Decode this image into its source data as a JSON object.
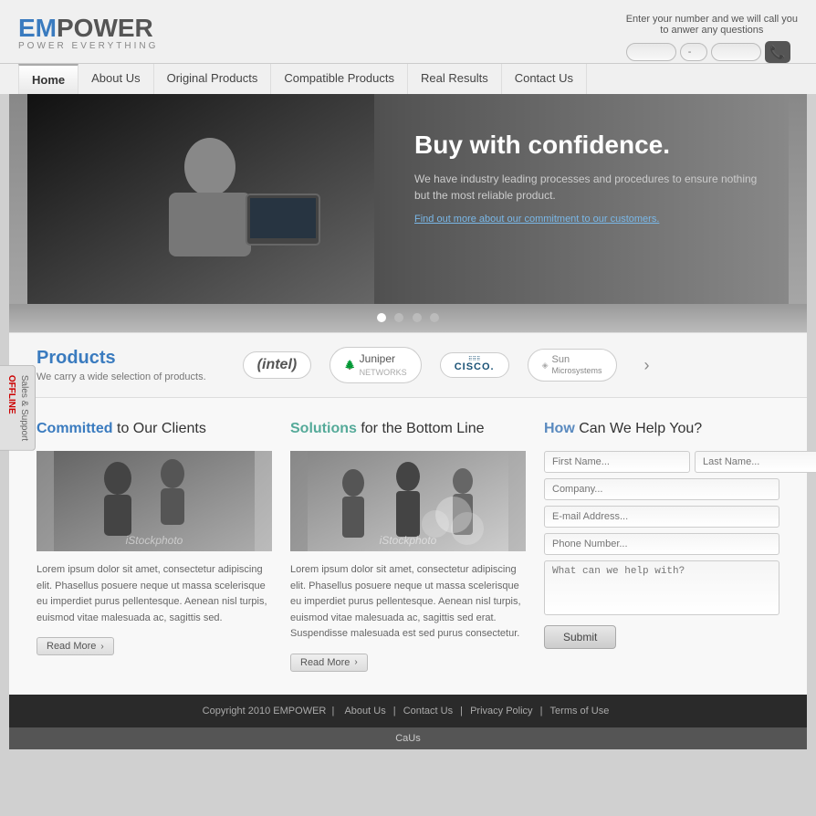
{
  "header": {
    "logo_em": "EM",
    "logo_power": "POWER",
    "logo_sub": "POWER  EVERYTHING",
    "call_label": "Enter your number and we will call you",
    "call_label2": "to anwer any questions",
    "phone_input1_placeholder": "",
    "phone_input2_placeholder": "-",
    "phone_input3_placeholder": ""
  },
  "nav": {
    "items": [
      {
        "label": "Home",
        "active": true
      },
      {
        "label": "About Us",
        "active": false
      },
      {
        "label": "Original Products",
        "active": false
      },
      {
        "label": "Compatible Products",
        "active": false
      },
      {
        "label": "Real Results",
        "active": false
      },
      {
        "label": "Contact Us",
        "active": false
      }
    ]
  },
  "hero": {
    "title": "Buy with confidence.",
    "description": "We have industry leading processes and procedures to ensure nothing but the most reliable product.",
    "link": "Find out more about our commitment to our customers.",
    "dots": [
      {
        "active": true
      },
      {
        "active": false
      },
      {
        "active": false
      },
      {
        "active": false
      }
    ]
  },
  "products": {
    "title": "Products",
    "subtitle": "We carry a wide selection of products.",
    "brands": [
      {
        "name": "intel",
        "display": "intel"
      },
      {
        "name": "juniper",
        "display": "Juniper NETWORKS"
      },
      {
        "name": "cisco",
        "display": "CISCO"
      },
      {
        "name": "sun",
        "display": "Sun Microsystems"
      }
    ],
    "arrow": "›"
  },
  "sidebar": {
    "line1": "Sales & Support",
    "line2": "OFFLINE"
  },
  "committed": {
    "title_highlight": "Committed",
    "title_rest": " to Our Clients",
    "image_watermark": "iStockphoto",
    "text": "Lorem ipsum dolor sit amet, consectetur adipiscing elit. Phasellus posuere neque ut massa scelerisque eu imperdiet purus pellentesque. Aenean nisl turpis, euismod vitae malesuada ac, sagittis sed.",
    "read_more": "Read More"
  },
  "solutions": {
    "title_highlight": "Solutions",
    "title_rest": " for the Bottom Line",
    "image_watermark": "iStockphoto",
    "text": "Lorem ipsum dolor sit amet, consectetur adipiscing elit. Phasellus posuere neque ut massa scelerisque eu imperdiet purus pellentesque. Aenean nisl turpis, euismod vitae malesuada ac, sagittis sed erat. Suspendisse malesuada est sed purus consectetur.",
    "read_more": "Read More"
  },
  "contact": {
    "title_highlight": "How",
    "title_rest": " Can We Help You?",
    "first_name_placeholder": "First Name...",
    "last_name_placeholder": "Last Name...",
    "company_placeholder": "Company...",
    "email_placeholder": "E-mail Address...",
    "phone_placeholder": "Phone Number...",
    "message_placeholder": "What can we help with?",
    "submit_label": "Submit"
  },
  "footer": {
    "copyright": "Copyright 2010 EMPOWER",
    "links": [
      "About Us",
      "Contact Us",
      "Privacy Policy",
      "Terms of Use"
    ],
    "bottom": "CaUs"
  },
  "colors": {
    "accent_blue": "#3a7bbf",
    "accent_light": "#7ab8e8",
    "dark_bg": "#2a2a2a",
    "nav_bg": "#f0f0f0"
  }
}
